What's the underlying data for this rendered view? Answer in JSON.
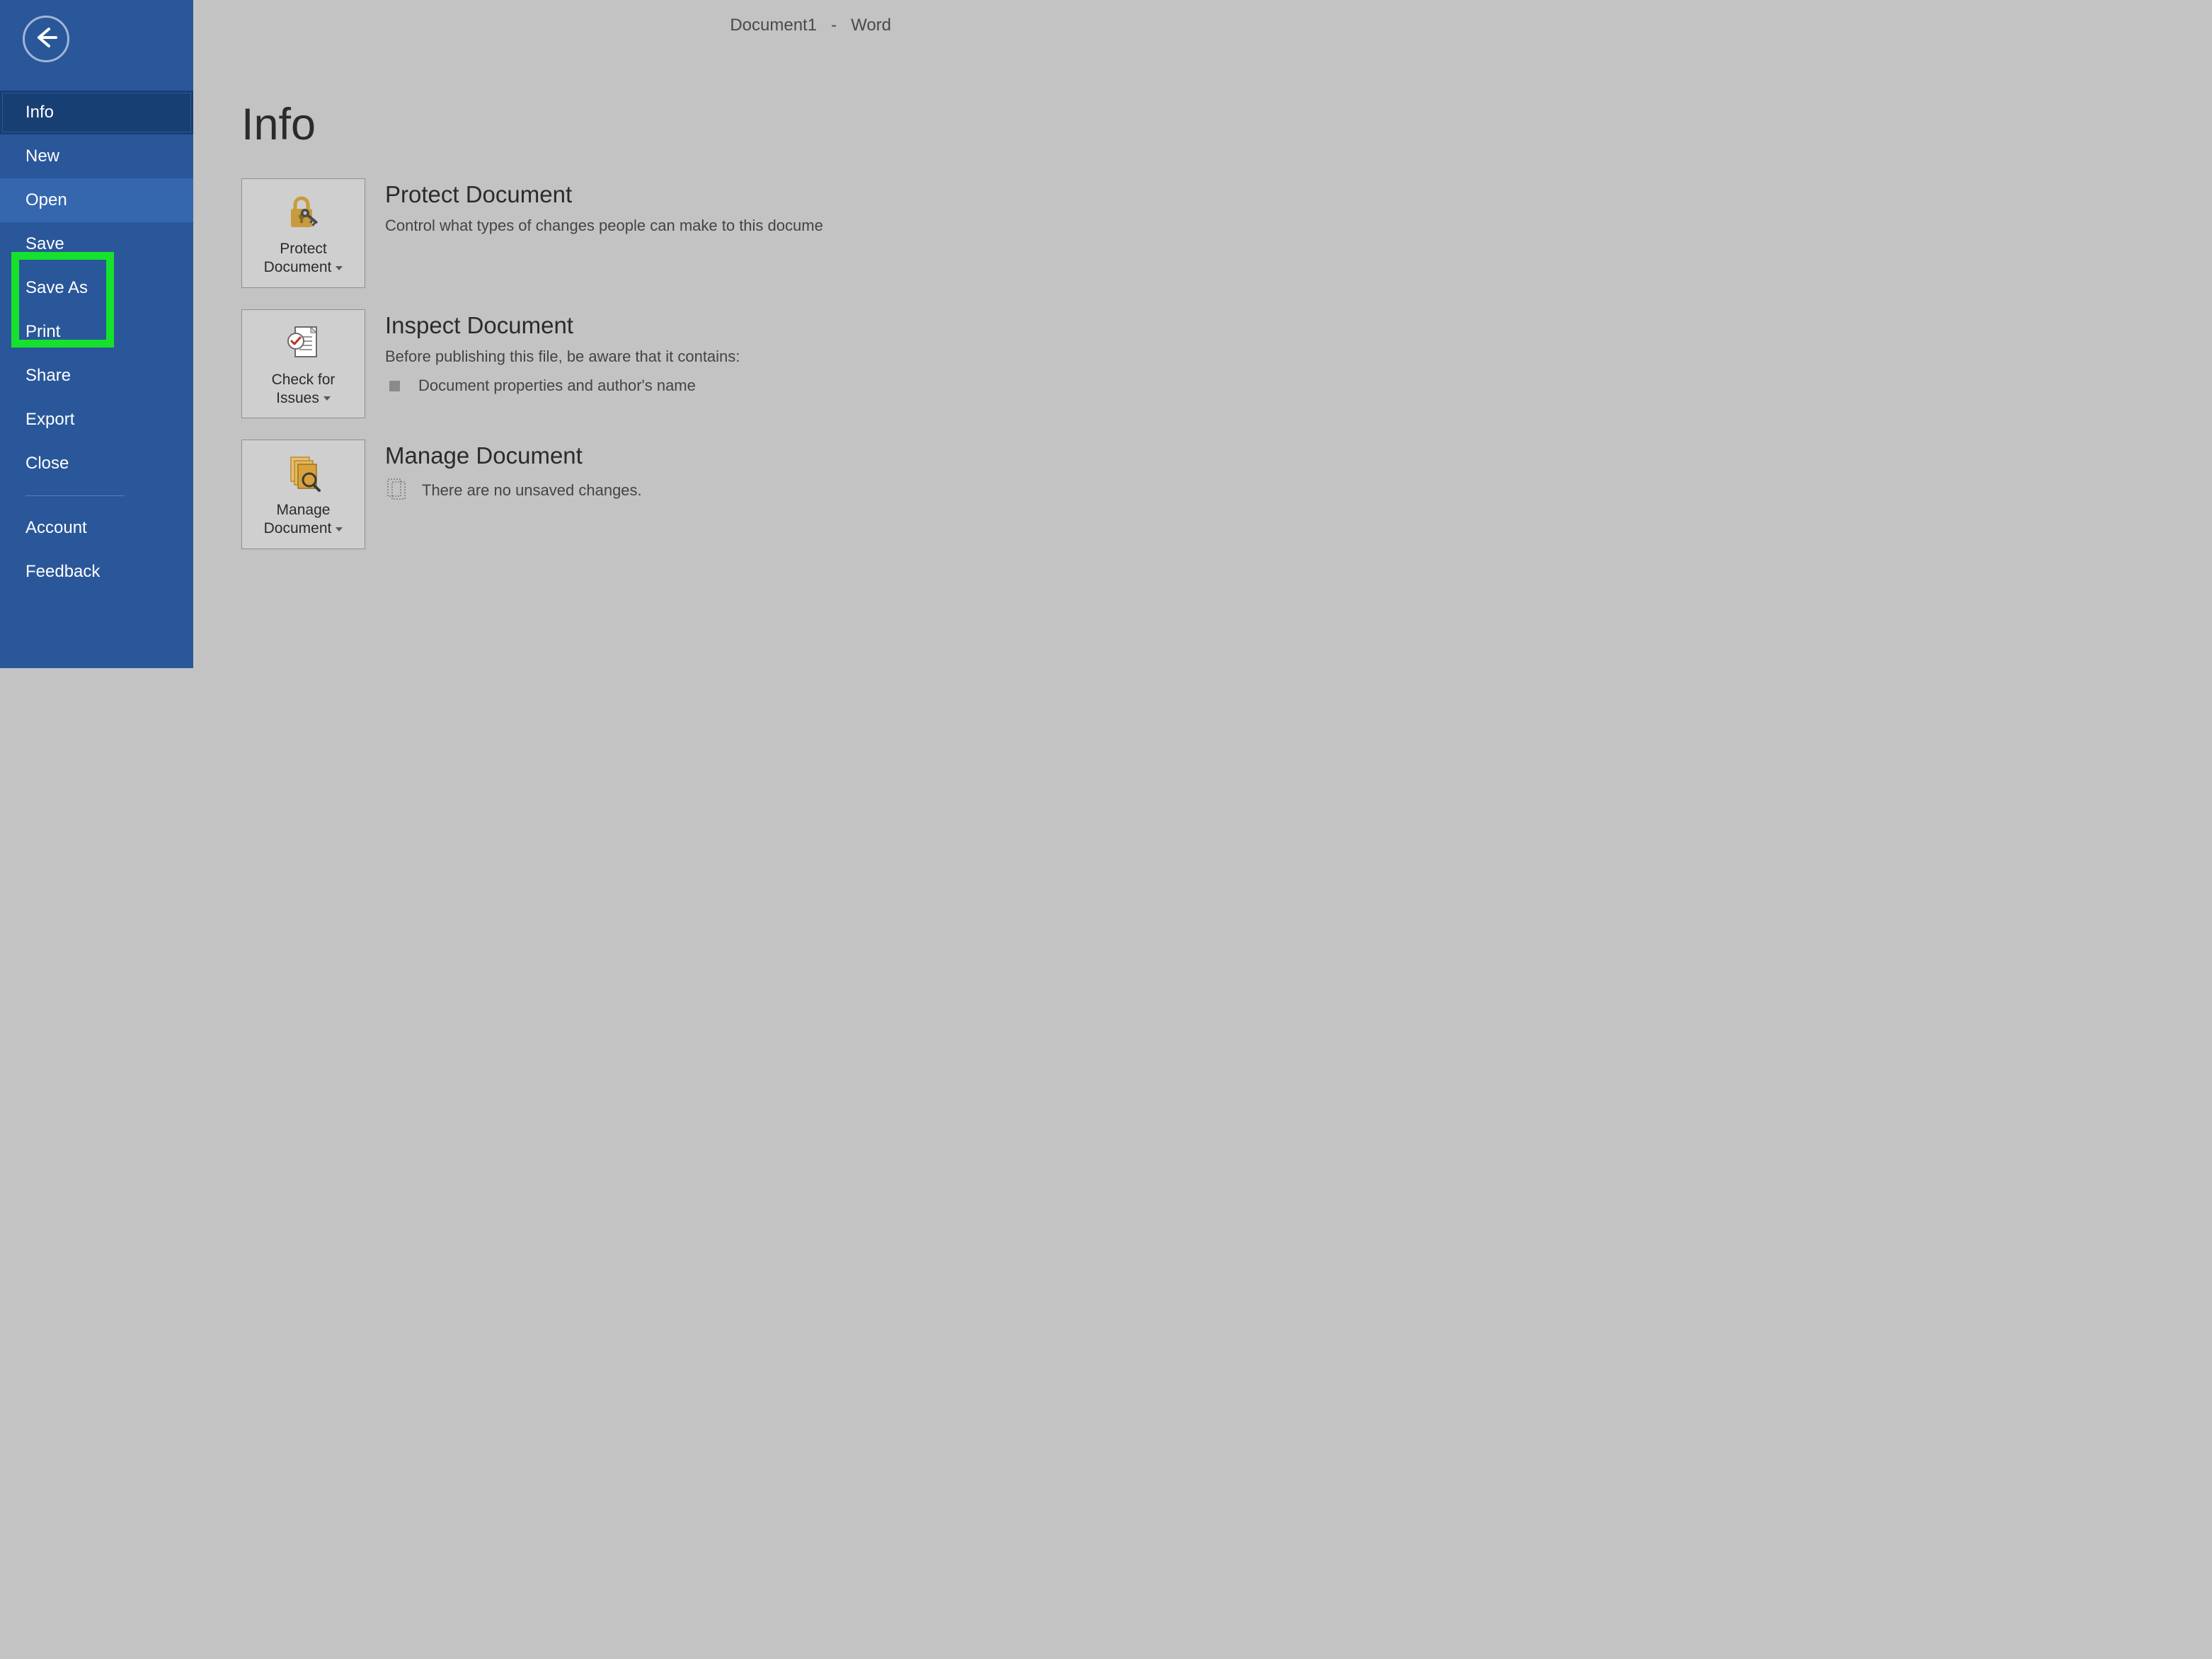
{
  "titlebar": {
    "doc_name": "Document1",
    "separator": "-",
    "app_name": "Word"
  },
  "sidebar": {
    "items": [
      {
        "label": "Info",
        "state": "selected"
      },
      {
        "label": "New",
        "state": ""
      },
      {
        "label": "Open",
        "state": "hover"
      },
      {
        "label": "Save",
        "state": ""
      },
      {
        "label": "Save As",
        "state": ""
      },
      {
        "label": "Print",
        "state": ""
      },
      {
        "label": "Share",
        "state": ""
      },
      {
        "label": "Export",
        "state": ""
      },
      {
        "label": "Close",
        "state": ""
      }
    ],
    "footer_items": [
      {
        "label": "Account"
      },
      {
        "label": "Feedback"
      }
    ],
    "highlighted_items": [
      "Save",
      "Save As"
    ],
    "highlight_color": "#16e22d"
  },
  "page": {
    "title": "Info",
    "sections": {
      "protect": {
        "button_line1": "Protect",
        "button_line2": "Document",
        "heading": "Protect Document",
        "description": "Control what types of changes people can make to this docume"
      },
      "inspect": {
        "button_line1": "Check for",
        "button_line2": "Issues",
        "heading": "Inspect Document",
        "description": "Before publishing this file, be aware that it contains:",
        "bullet": "Document properties and author's name"
      },
      "manage": {
        "button_line1": "Manage",
        "button_line2": "Document",
        "heading": "Manage Document",
        "status": "There are no unsaved changes."
      }
    }
  },
  "colors": {
    "sidebar_bg": "#2a579a",
    "sidebar_selected": "#183f74",
    "sidebar_hover": "#3567af",
    "main_bg": "#c3c3c3",
    "button_bg": "#cfcfcf",
    "lock_gold": "#c89b3c",
    "check_red": "#b93027",
    "manage_amber": "#d9a13b"
  }
}
